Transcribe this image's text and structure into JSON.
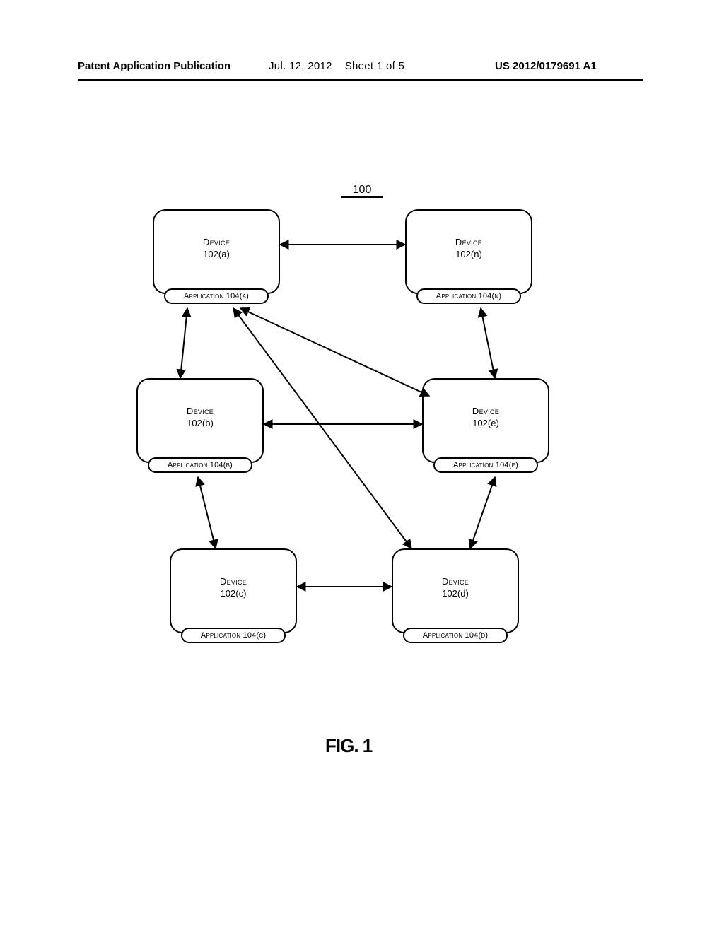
{
  "header": {
    "left": "Patent Application Publication",
    "mid_date": "Jul. 12, 2012",
    "mid_sheet": "Sheet 1 of 5",
    "right": "US 2012/0179691 A1"
  },
  "figure": {
    "ref": "100",
    "caption": "FIG. 1"
  },
  "devices": {
    "a": {
      "label": "Device",
      "id": "102(a)",
      "app": "Application 104(a)"
    },
    "n": {
      "label": "Device",
      "id": "102(n)",
      "app": "Application 104(n)"
    },
    "b": {
      "label": "Device",
      "id": "102(b)",
      "app": "Application 104(b)"
    },
    "e": {
      "label": "Device",
      "id": "102(e)",
      "app": "Application 104(e)"
    },
    "c": {
      "label": "Device",
      "id": "102(c)",
      "app": "Application 104(c)"
    },
    "d": {
      "label": "Device",
      "id": "102(d)",
      "app": "Application 104(d)"
    }
  }
}
